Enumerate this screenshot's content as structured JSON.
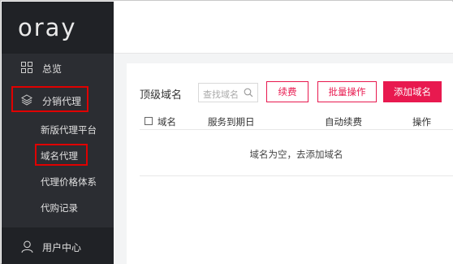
{
  "brand": {
    "logo_text": "oray"
  },
  "sidebar": {
    "items": [
      {
        "label": "总览",
        "icon": "grid-icon"
      },
      {
        "label": "分销代理",
        "icon": "layers-icon",
        "highlighted": true
      },
      {
        "label": "用户中心",
        "icon": "user-icon"
      }
    ],
    "sub_items": [
      {
        "label": "新版代理平台"
      },
      {
        "label": "域名代理",
        "highlighted": true
      },
      {
        "label": "代理价格体系"
      },
      {
        "label": "代购记录"
      }
    ]
  },
  "main": {
    "section_title": "顶级域名",
    "search_placeholder": "查找域名",
    "buttons": {
      "renew": "续费",
      "batch": "批量操作",
      "add": "添加域名"
    },
    "table": {
      "columns": [
        "域名",
        "服务到期日",
        "自动续费",
        "操作"
      ],
      "empty_text": "域名为空，去添加域名"
    }
  },
  "colors": {
    "accent": "#e8194f",
    "sidebar_bg": "#2b2d32",
    "highlight_border": "#e00000"
  }
}
